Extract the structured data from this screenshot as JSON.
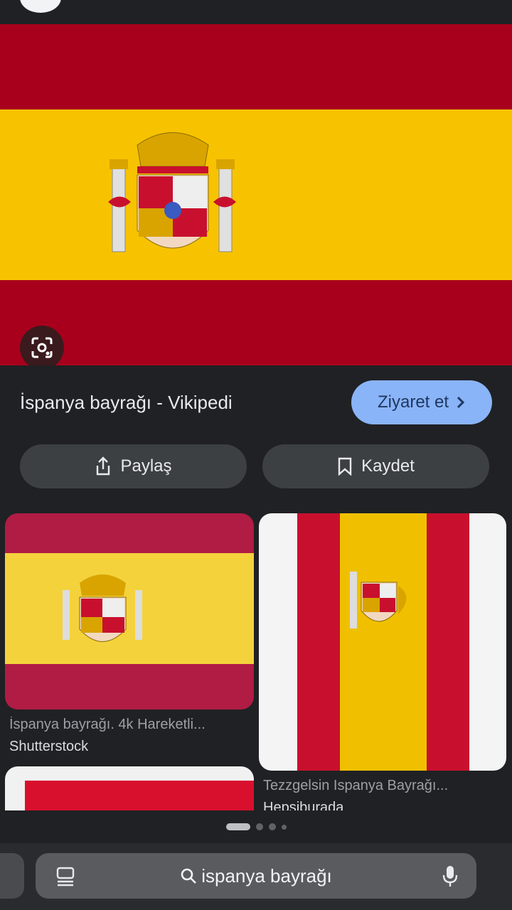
{
  "result": {
    "title": "İspanya bayrağı - Vikipedi",
    "visit_label": "Ziyaret et",
    "share_label": "Paylaş",
    "save_label": "Kaydet"
  },
  "related": [
    {
      "caption": "İspanya bayrağı. 4k Hareketli...",
      "source": "Shutterstock"
    },
    {
      "caption": "Tezzgelsin Ispanya Bayrağı...",
      "source": "Hepsiburada"
    }
  ],
  "pager": {
    "total": 4,
    "active": 1
  },
  "search": {
    "query": "ispanya bayrağı"
  },
  "colors": {
    "flag_red": "#a8001c",
    "flag_yellow": "#f7c300",
    "accent": "#8ab4f8"
  },
  "icons": [
    "lens-icon",
    "chevron-right-icon",
    "share-icon",
    "bookmark-icon",
    "tabs-icon",
    "search-icon",
    "mic-icon"
  ]
}
